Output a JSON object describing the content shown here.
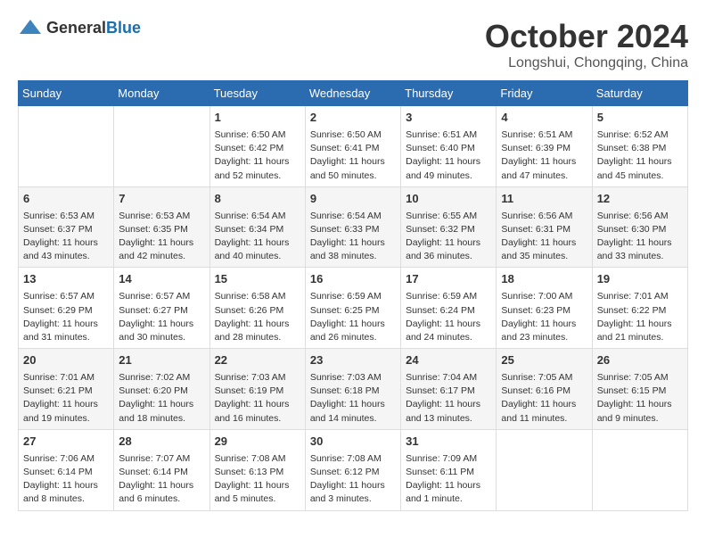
{
  "header": {
    "logo_general": "General",
    "logo_blue": "Blue",
    "month_title": "October 2024",
    "location": "Longshui, Chongqing, China"
  },
  "days_of_week": [
    "Sunday",
    "Monday",
    "Tuesday",
    "Wednesday",
    "Thursday",
    "Friday",
    "Saturday"
  ],
  "weeks": [
    [
      {
        "day": "",
        "info": ""
      },
      {
        "day": "",
        "info": ""
      },
      {
        "day": "1",
        "info": "Sunrise: 6:50 AM\nSunset: 6:42 PM\nDaylight: 11 hours\nand 52 minutes."
      },
      {
        "day": "2",
        "info": "Sunrise: 6:50 AM\nSunset: 6:41 PM\nDaylight: 11 hours\nand 50 minutes."
      },
      {
        "day": "3",
        "info": "Sunrise: 6:51 AM\nSunset: 6:40 PM\nDaylight: 11 hours\nand 49 minutes."
      },
      {
        "day": "4",
        "info": "Sunrise: 6:51 AM\nSunset: 6:39 PM\nDaylight: 11 hours\nand 47 minutes."
      },
      {
        "day": "5",
        "info": "Sunrise: 6:52 AM\nSunset: 6:38 PM\nDaylight: 11 hours\nand 45 minutes."
      }
    ],
    [
      {
        "day": "6",
        "info": "Sunrise: 6:53 AM\nSunset: 6:37 PM\nDaylight: 11 hours\nand 43 minutes."
      },
      {
        "day": "7",
        "info": "Sunrise: 6:53 AM\nSunset: 6:35 PM\nDaylight: 11 hours\nand 42 minutes."
      },
      {
        "day": "8",
        "info": "Sunrise: 6:54 AM\nSunset: 6:34 PM\nDaylight: 11 hours\nand 40 minutes."
      },
      {
        "day": "9",
        "info": "Sunrise: 6:54 AM\nSunset: 6:33 PM\nDaylight: 11 hours\nand 38 minutes."
      },
      {
        "day": "10",
        "info": "Sunrise: 6:55 AM\nSunset: 6:32 PM\nDaylight: 11 hours\nand 36 minutes."
      },
      {
        "day": "11",
        "info": "Sunrise: 6:56 AM\nSunset: 6:31 PM\nDaylight: 11 hours\nand 35 minutes."
      },
      {
        "day": "12",
        "info": "Sunrise: 6:56 AM\nSunset: 6:30 PM\nDaylight: 11 hours\nand 33 minutes."
      }
    ],
    [
      {
        "day": "13",
        "info": "Sunrise: 6:57 AM\nSunset: 6:29 PM\nDaylight: 11 hours\nand 31 minutes."
      },
      {
        "day": "14",
        "info": "Sunrise: 6:57 AM\nSunset: 6:27 PM\nDaylight: 11 hours\nand 30 minutes."
      },
      {
        "day": "15",
        "info": "Sunrise: 6:58 AM\nSunset: 6:26 PM\nDaylight: 11 hours\nand 28 minutes."
      },
      {
        "day": "16",
        "info": "Sunrise: 6:59 AM\nSunset: 6:25 PM\nDaylight: 11 hours\nand 26 minutes."
      },
      {
        "day": "17",
        "info": "Sunrise: 6:59 AM\nSunset: 6:24 PM\nDaylight: 11 hours\nand 24 minutes."
      },
      {
        "day": "18",
        "info": "Sunrise: 7:00 AM\nSunset: 6:23 PM\nDaylight: 11 hours\nand 23 minutes."
      },
      {
        "day": "19",
        "info": "Sunrise: 7:01 AM\nSunset: 6:22 PM\nDaylight: 11 hours\nand 21 minutes."
      }
    ],
    [
      {
        "day": "20",
        "info": "Sunrise: 7:01 AM\nSunset: 6:21 PM\nDaylight: 11 hours\nand 19 minutes."
      },
      {
        "day": "21",
        "info": "Sunrise: 7:02 AM\nSunset: 6:20 PM\nDaylight: 11 hours\nand 18 minutes."
      },
      {
        "day": "22",
        "info": "Sunrise: 7:03 AM\nSunset: 6:19 PM\nDaylight: 11 hours\nand 16 minutes."
      },
      {
        "day": "23",
        "info": "Sunrise: 7:03 AM\nSunset: 6:18 PM\nDaylight: 11 hours\nand 14 minutes."
      },
      {
        "day": "24",
        "info": "Sunrise: 7:04 AM\nSunset: 6:17 PM\nDaylight: 11 hours\nand 13 minutes."
      },
      {
        "day": "25",
        "info": "Sunrise: 7:05 AM\nSunset: 6:16 PM\nDaylight: 11 hours\nand 11 minutes."
      },
      {
        "day": "26",
        "info": "Sunrise: 7:05 AM\nSunset: 6:15 PM\nDaylight: 11 hours\nand 9 minutes."
      }
    ],
    [
      {
        "day": "27",
        "info": "Sunrise: 7:06 AM\nSunset: 6:14 PM\nDaylight: 11 hours\nand 8 minutes."
      },
      {
        "day": "28",
        "info": "Sunrise: 7:07 AM\nSunset: 6:14 PM\nDaylight: 11 hours\nand 6 minutes."
      },
      {
        "day": "29",
        "info": "Sunrise: 7:08 AM\nSunset: 6:13 PM\nDaylight: 11 hours\nand 5 minutes."
      },
      {
        "day": "30",
        "info": "Sunrise: 7:08 AM\nSunset: 6:12 PM\nDaylight: 11 hours\nand 3 minutes."
      },
      {
        "day": "31",
        "info": "Sunrise: 7:09 AM\nSunset: 6:11 PM\nDaylight: 11 hours\nand 1 minute."
      },
      {
        "day": "",
        "info": ""
      },
      {
        "day": "",
        "info": ""
      }
    ]
  ]
}
